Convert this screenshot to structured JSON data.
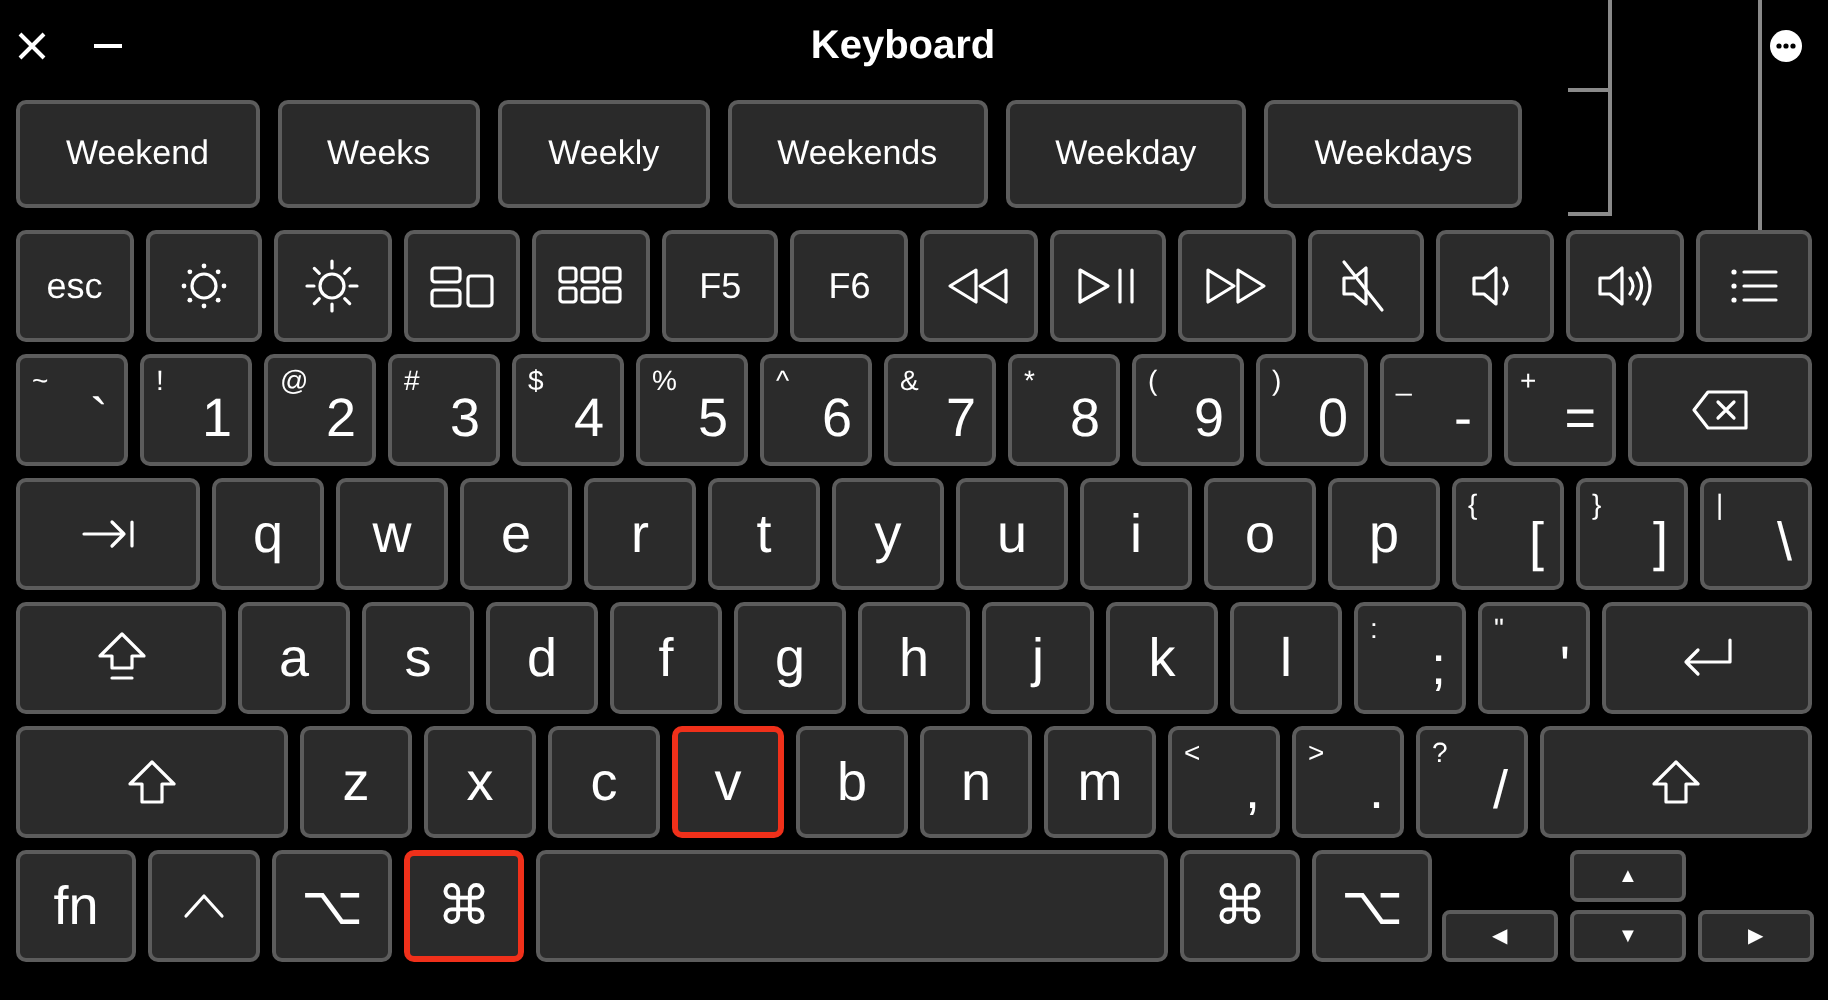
{
  "window": {
    "title": "Keyboard"
  },
  "suggestions": [
    "Weekend",
    "Weeks",
    "Weekly",
    "Weekends",
    "Weekday",
    "Weekdays"
  ],
  "function_keys": [
    {
      "kind": "label",
      "label": "esc"
    },
    {
      "kind": "icon"
    },
    {
      "kind": "icon"
    },
    {
      "kind": "icon"
    },
    {
      "kind": "icon"
    },
    {
      "kind": "label",
      "label": "F5"
    },
    {
      "kind": "label",
      "label": "F6"
    },
    {
      "kind": "icon"
    },
    {
      "kind": "icon"
    },
    {
      "kind": "icon"
    },
    {
      "kind": "icon"
    },
    {
      "kind": "icon"
    },
    {
      "kind": "icon"
    },
    {
      "kind": "icon"
    }
  ],
  "rows": [
    {
      "keys": [
        {
          "kind": "dual",
          "upper": "~",
          "lower": "`",
          "highlighted": false
        },
        {
          "kind": "dual",
          "upper": "!",
          "lower": "1",
          "highlighted": false
        },
        {
          "kind": "dual",
          "upper": "@",
          "lower": "2",
          "highlighted": false
        },
        {
          "kind": "dual",
          "upper": "#",
          "lower": "3",
          "highlighted": false
        },
        {
          "kind": "dual",
          "upper": "$",
          "lower": "4",
          "highlighted": false
        },
        {
          "kind": "dual",
          "upper": "%",
          "lower": "5",
          "highlighted": false
        },
        {
          "kind": "dual",
          "upper": "^",
          "lower": "6",
          "highlighted": false
        },
        {
          "kind": "dual",
          "upper": "&",
          "lower": "7",
          "highlighted": false
        },
        {
          "kind": "dual",
          "upper": "*",
          "lower": "8",
          "highlighted": false
        },
        {
          "kind": "dual",
          "upper": "(",
          "lower": "9",
          "highlighted": false
        },
        {
          "kind": "dual",
          "upper": ")",
          "lower": "0",
          "highlighted": false
        },
        {
          "kind": "dual",
          "upper": "_",
          "lower": "-",
          "highlighted": false
        },
        {
          "kind": "dual",
          "upper": "+",
          "lower": "=",
          "highlighted": false
        },
        {
          "kind": "delete",
          "highlighted": false
        }
      ]
    },
    {
      "keys": [
        {
          "kind": "tab",
          "highlighted": false
        },
        {
          "kind": "char",
          "label": "q",
          "highlighted": false
        },
        {
          "kind": "char",
          "label": "w",
          "highlighted": false
        },
        {
          "kind": "char",
          "label": "e",
          "highlighted": false
        },
        {
          "kind": "char",
          "label": "r",
          "highlighted": false
        },
        {
          "kind": "char",
          "label": "t",
          "highlighted": false
        },
        {
          "kind": "char",
          "label": "y",
          "highlighted": false
        },
        {
          "kind": "char",
          "label": "u",
          "highlighted": false
        },
        {
          "kind": "char",
          "label": "i",
          "highlighted": false
        },
        {
          "kind": "char",
          "label": "o",
          "highlighted": false
        },
        {
          "kind": "char",
          "label": "p",
          "highlighted": false
        },
        {
          "kind": "dual",
          "upper": "{",
          "lower": "[",
          "highlighted": false
        },
        {
          "kind": "dual",
          "upper": "}",
          "lower": "]",
          "highlighted": false
        },
        {
          "kind": "dual",
          "upper": "|",
          "lower": "\\",
          "highlighted": false
        }
      ]
    },
    {
      "keys": [
        {
          "kind": "caps",
          "highlighted": false
        },
        {
          "kind": "char",
          "label": "a",
          "highlighted": false
        },
        {
          "kind": "char",
          "label": "s",
          "highlighted": false
        },
        {
          "kind": "char",
          "label": "d",
          "highlighted": false
        },
        {
          "kind": "char",
          "label": "f",
          "highlighted": false
        },
        {
          "kind": "char",
          "label": "g",
          "highlighted": false
        },
        {
          "kind": "char",
          "label": "h",
          "highlighted": false
        },
        {
          "kind": "char",
          "label": "j",
          "highlighted": false
        },
        {
          "kind": "char",
          "label": "k",
          "highlighted": false
        },
        {
          "kind": "char",
          "label": "l",
          "highlighted": false
        },
        {
          "kind": "dual",
          "upper": ":",
          "lower": ";",
          "highlighted": false
        },
        {
          "kind": "dual",
          "upper": "\"",
          "lower": "'",
          "highlighted": false
        },
        {
          "kind": "return",
          "highlighted": false
        }
      ]
    },
    {
      "keys": [
        {
          "kind": "shift",
          "highlighted": false
        },
        {
          "kind": "char",
          "label": "z",
          "highlighted": false
        },
        {
          "kind": "char",
          "label": "x",
          "highlighted": false
        },
        {
          "kind": "char",
          "label": "c",
          "highlighted": false
        },
        {
          "kind": "char",
          "label": "v",
          "highlighted": true
        },
        {
          "kind": "char",
          "label": "b",
          "highlighted": false
        },
        {
          "kind": "char",
          "label": "n",
          "highlighted": false
        },
        {
          "kind": "char",
          "label": "m",
          "highlighted": false
        },
        {
          "kind": "dual",
          "upper": "<",
          "lower": ",",
          "highlighted": false
        },
        {
          "kind": "dual",
          "upper": ">",
          "lower": ".",
          "highlighted": false
        },
        {
          "kind": "dual",
          "upper": "?",
          "lower": "/",
          "highlighted": false
        },
        {
          "kind": "shift",
          "highlighted": false
        }
      ]
    },
    {
      "keys": [
        {
          "kind": "mod",
          "label": "fn",
          "highlighted": false
        },
        {
          "kind": "control",
          "highlighted": false
        },
        {
          "kind": "mod",
          "label": "⌥",
          "highlighted": false
        },
        {
          "kind": "mod",
          "label": "⌘",
          "highlighted": true
        },
        {
          "kind": "space",
          "highlighted": false
        },
        {
          "kind": "mod",
          "label": "⌘",
          "highlighted": false
        },
        {
          "kind": "mod",
          "label": "⌥",
          "highlighted": false
        },
        {
          "kind": "arrows",
          "up": "▲",
          "left": "◀",
          "down": "▼",
          "right": "▶",
          "highlighted": false
        }
      ]
    }
  ]
}
